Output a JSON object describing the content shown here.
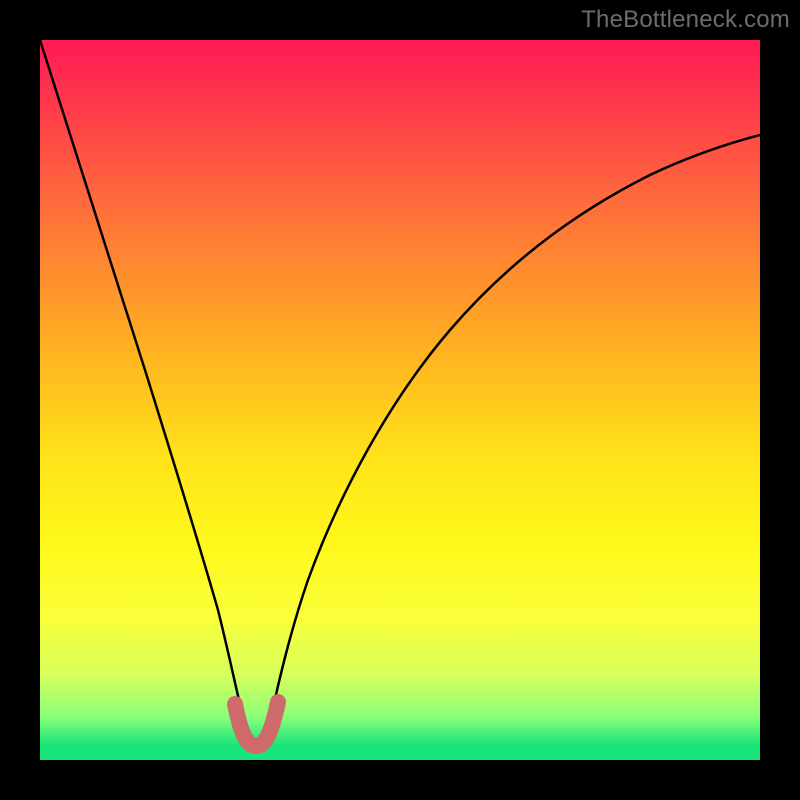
{
  "watermark": {
    "text": "TheBottleneck.com"
  },
  "chart_data": {
    "type": "line",
    "title": "",
    "xlabel": "",
    "ylabel": "",
    "xlim": [
      0,
      100
    ],
    "ylim": [
      0,
      100
    ],
    "grid": false,
    "legend": false,
    "series": [
      {
        "name": "bottleneck-curve",
        "x": [
          0,
          3,
          6,
          9,
          12,
          15,
          18,
          20,
          22,
          24,
          26,
          27,
          28,
          29,
          30,
          31,
          32,
          33,
          35,
          38,
          42,
          47,
          53,
          60,
          68,
          77,
          87,
          100
        ],
        "y": [
          100,
          90,
          80,
          70,
          60,
          50,
          40,
          33,
          26,
          19,
          12,
          8,
          5,
          3,
          2,
          3,
          5,
          8,
          14,
          22,
          31,
          40,
          48,
          55,
          62,
          68,
          73,
          78
        ],
        "color": "#000000",
        "linewidth": 2
      },
      {
        "name": "trough-highlight",
        "x": [
          26,
          27,
          28,
          29,
          30,
          31,
          32,
          33
        ],
        "y": [
          12,
          8,
          5,
          3,
          2,
          3,
          5,
          8
        ],
        "color": "#cf6a6a",
        "linewidth": 14
      }
    ],
    "annotations": []
  }
}
